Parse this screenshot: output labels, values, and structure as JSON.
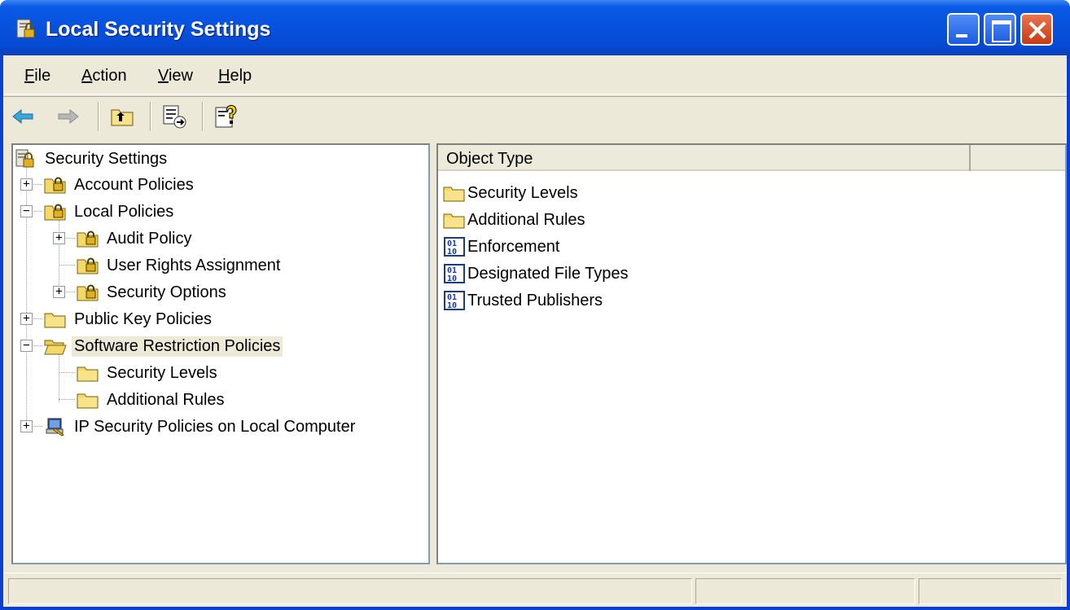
{
  "window": {
    "title": "Local Security Settings",
    "icon": "security-settings-icon",
    "controls": [
      "minimize",
      "maximize",
      "close"
    ]
  },
  "menu": [
    {
      "label": "File",
      "accel": "F"
    },
    {
      "label": "Action",
      "accel": "A"
    },
    {
      "label": "View",
      "accel": "V"
    },
    {
      "label": "Help",
      "accel": "H"
    }
  ],
  "toolbar": [
    "back-arrow-icon",
    "forward-arrow-icon",
    "up-folder-icon",
    "export-list-icon",
    "help-icon"
  ],
  "tree": [
    {
      "label": "Security Settings",
      "icon": "security-settings-icon",
      "level": 0,
      "expander": ""
    },
    {
      "label": "Account Policies",
      "icon": "locked-folder-icon",
      "level": 1,
      "expander": "+"
    },
    {
      "label": "Local Policies",
      "icon": "locked-folder-icon",
      "level": 1,
      "expander": "-"
    },
    {
      "label": "Audit Policy",
      "icon": "locked-folder-icon",
      "level": 2,
      "expander": "+"
    },
    {
      "label": "User Rights Assignment",
      "icon": "locked-folder-icon",
      "level": 2,
      "expander": ""
    },
    {
      "label": "Security Options",
      "icon": "locked-folder-icon",
      "level": 2,
      "expander": "+"
    },
    {
      "label": "Public Key Policies",
      "icon": "folder-icon",
      "level": 1,
      "expander": "+"
    },
    {
      "label": "Software Restriction Policies",
      "icon": "open-folder-icon",
      "level": 1,
      "expander": "-",
      "selected": true
    },
    {
      "label": "Security Levels",
      "icon": "folder-icon",
      "level": 2,
      "expander": ""
    },
    {
      "label": "Additional Rules",
      "icon": "folder-icon",
      "level": 2,
      "expander": ""
    },
    {
      "label": "IP Security Policies on Local Computer",
      "icon": "ip-security-icon",
      "level": 1,
      "expander": "+"
    }
  ],
  "list": {
    "column_header": "Object Type",
    "items": [
      {
        "label": "Security Levels",
        "icon": "folder-icon"
      },
      {
        "label": "Additional Rules",
        "icon": "folder-icon"
      },
      {
        "label": "Enforcement",
        "icon": "binary-policy-icon"
      },
      {
        "label": "Designated File Types",
        "icon": "binary-policy-icon"
      },
      {
        "label": "Trusted Publishers",
        "icon": "binary-policy-icon"
      }
    ]
  },
  "colors": {
    "titlebar": "#0751dd",
    "face": "#ece9d8",
    "selection": "#ece9d8"
  }
}
